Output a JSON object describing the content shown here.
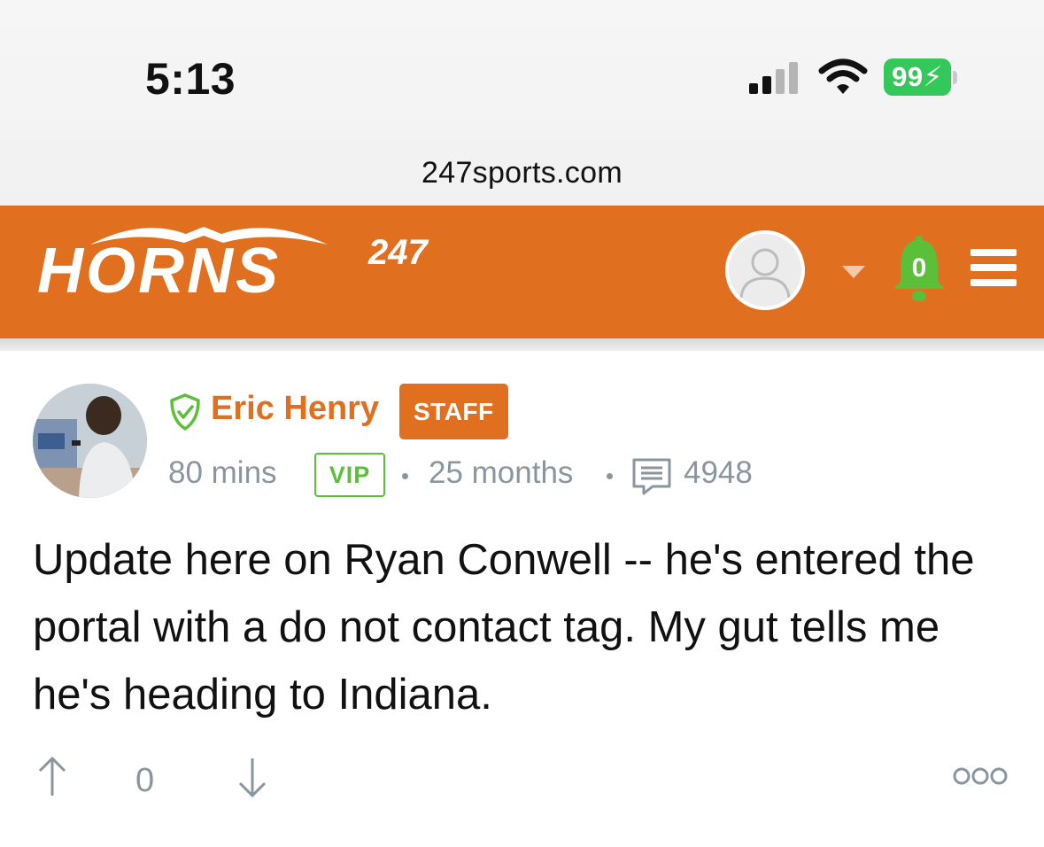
{
  "status_bar": {
    "time": "5:13",
    "battery": "99",
    "signal_icon": "cellular-signal-icon",
    "wifi_icon": "wifi-icon",
    "battery_color": "#34c759"
  },
  "browser": {
    "url": "247sports.com"
  },
  "header": {
    "brand_color": "#e06f1f",
    "logo_text": "HORNS",
    "logo_suffix": "247",
    "notification_count": "0",
    "profile_icon": "user-avatar-icon",
    "bell_icon": "bell-icon",
    "menu_icon": "hamburger-menu-icon"
  },
  "post": {
    "author": "Eric Henry",
    "role_badge": "STAFF",
    "verified_icon": "shield-check-icon",
    "posted_ago": "80 mins",
    "membership_badge": "VIP",
    "tenure": "25 months",
    "post_count": "4948",
    "posts_icon": "comment-icon",
    "body": "Update here on Ryan Conwell -- he's entered the portal with a do not contact tag. My gut tells me he's heading to Indiana.",
    "votes": "0",
    "upvote_icon": "arrow-up-icon",
    "downvote_icon": "arrow-down-icon",
    "more_icon": "more-options-icon"
  }
}
